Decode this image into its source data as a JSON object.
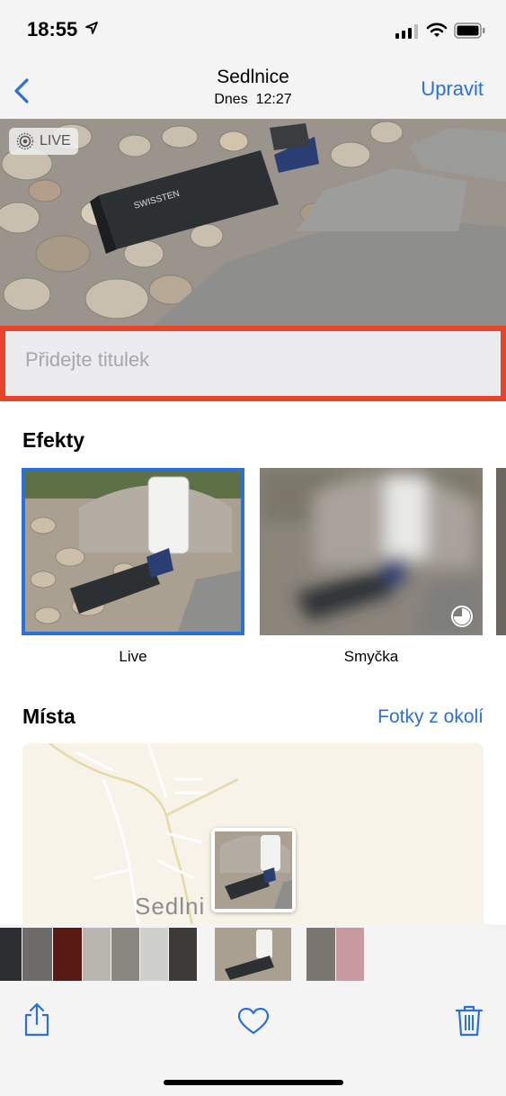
{
  "status_bar": {
    "time": "18:55"
  },
  "nav": {
    "title": "Sedlnice",
    "date": "Dnes",
    "time": "12:27",
    "edit_label": "Upravit"
  },
  "photo": {
    "live_label": "LIVE"
  },
  "caption": {
    "placeholder": "Přidejte titulek"
  },
  "effects": {
    "title": "Efekty",
    "items": [
      {
        "label": "Live"
      },
      {
        "label": "Smyčka"
      }
    ]
  },
  "places": {
    "title": "Místa",
    "nearby_label": "Fotky z okolí",
    "city_label": "Sedlni"
  },
  "colors": {
    "accent": "#2b70d9",
    "highlight_border": "#e8432b"
  },
  "icons": [
    "back-chevron-icon",
    "location-arrow-icon",
    "signal-icon",
    "wifi-icon",
    "battery-icon",
    "live-photo-icon",
    "share-icon",
    "heart-icon",
    "trash-icon",
    "loop-icon"
  ]
}
